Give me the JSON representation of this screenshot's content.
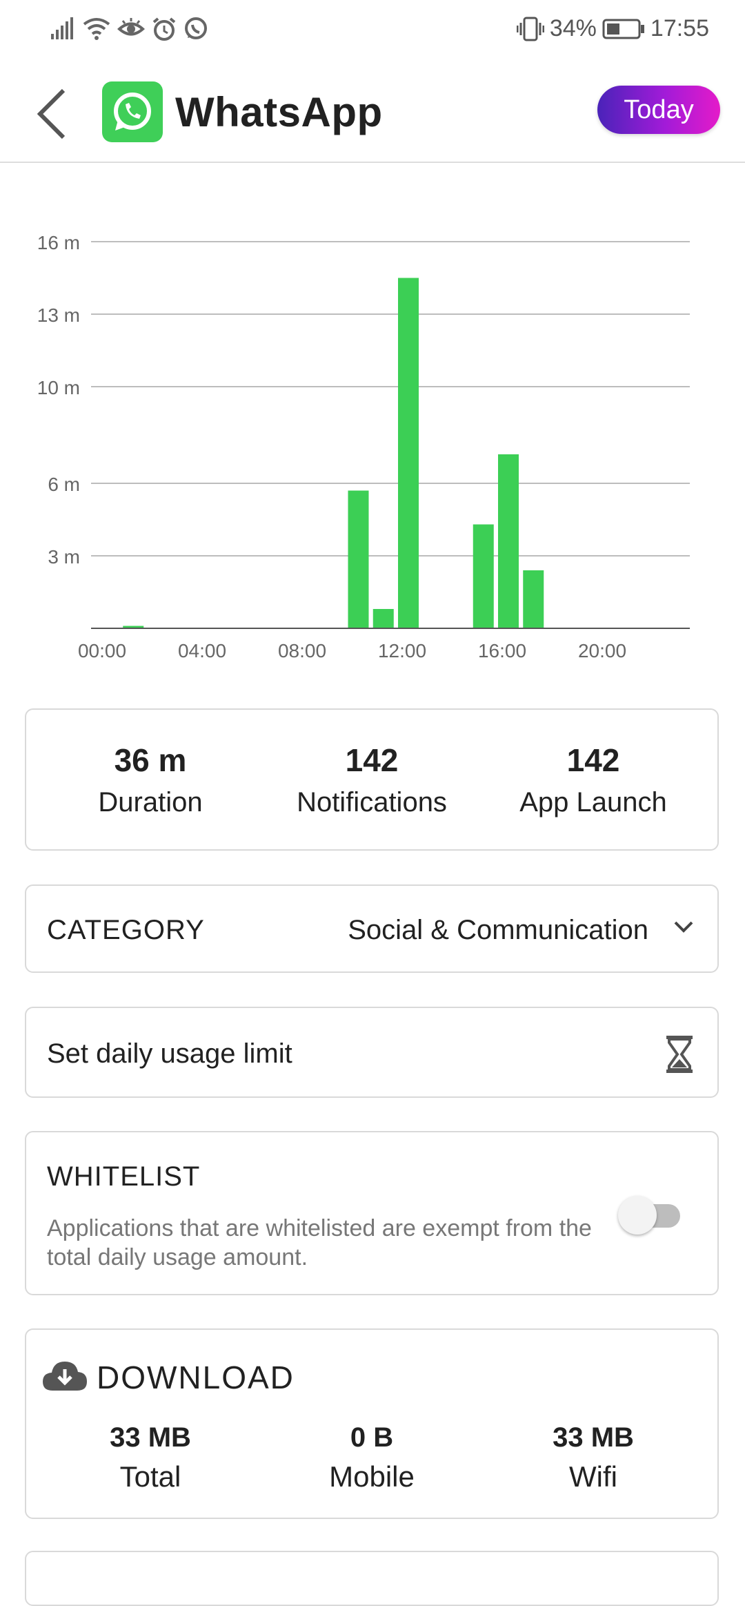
{
  "status_bar": {
    "battery_percent": "34%",
    "time": "17:55",
    "icons": [
      "signal-icon",
      "wifi-icon",
      "eye-icon",
      "alarm-icon",
      "whatsapp-notification-icon",
      "vibrate-icon",
      "battery-icon"
    ]
  },
  "header": {
    "title": "WhatsApp",
    "period_button": "Today",
    "accent_gradient": [
      "#4a23b9",
      "#e41bc9"
    ],
    "app_icon_color": "#3fcf58"
  },
  "chart_data": {
    "type": "bar",
    "bar_color": "#3ccf55",
    "y_ticks": [
      {
        "label": "3 m",
        "value": 3
      },
      {
        "label": "6 m",
        "value": 6
      },
      {
        "label": "10 m",
        "value": 10
      },
      {
        "label": "13 m",
        "value": 13
      },
      {
        "label": "16 m",
        "value": 16
      }
    ],
    "ylim": [
      0,
      16
    ],
    "x_ticks": [
      {
        "label": "00:00",
        "hour": 0
      },
      {
        "label": "04:00",
        "hour": 4
      },
      {
        "label": "08:00",
        "hour": 8
      },
      {
        "label": "12:00",
        "hour": 12
      },
      {
        "label": "16:00",
        "hour": 16
      },
      {
        "label": "20:00",
        "hour": 20
      }
    ],
    "xlim": [
      0,
      24
    ],
    "bars": [
      {
        "hour": 1,
        "value": 0.1
      },
      {
        "hour": 10,
        "value": 5.7
      },
      {
        "hour": 11,
        "value": 0.8
      },
      {
        "hour": 12,
        "value": 14.5
      },
      {
        "hour": 15,
        "value": 4.3
      },
      {
        "hour": 16,
        "value": 7.2
      },
      {
        "hour": 17,
        "value": 2.4
      }
    ],
    "grid": true
  },
  "stats": {
    "duration_value": "36 m",
    "duration_label": "Duration",
    "notifications_value": "142",
    "notifications_label": "Notifications",
    "launch_value": "142",
    "launch_label": "App Launch"
  },
  "category": {
    "label": "CATEGORY",
    "value": "Social & Communication"
  },
  "limit": {
    "label": "Set daily usage limit"
  },
  "whitelist": {
    "title": "WHITELIST",
    "description": "Applications that are whitelisted are exempt from the total daily usage amount.",
    "enabled": false
  },
  "download": {
    "title": "DOWNLOAD",
    "total_value": "33 MB",
    "total_label": "Total",
    "mobile_value": "0 B",
    "mobile_label": "Mobile",
    "wifi_value": "33 MB",
    "wifi_label": "Wifi"
  }
}
